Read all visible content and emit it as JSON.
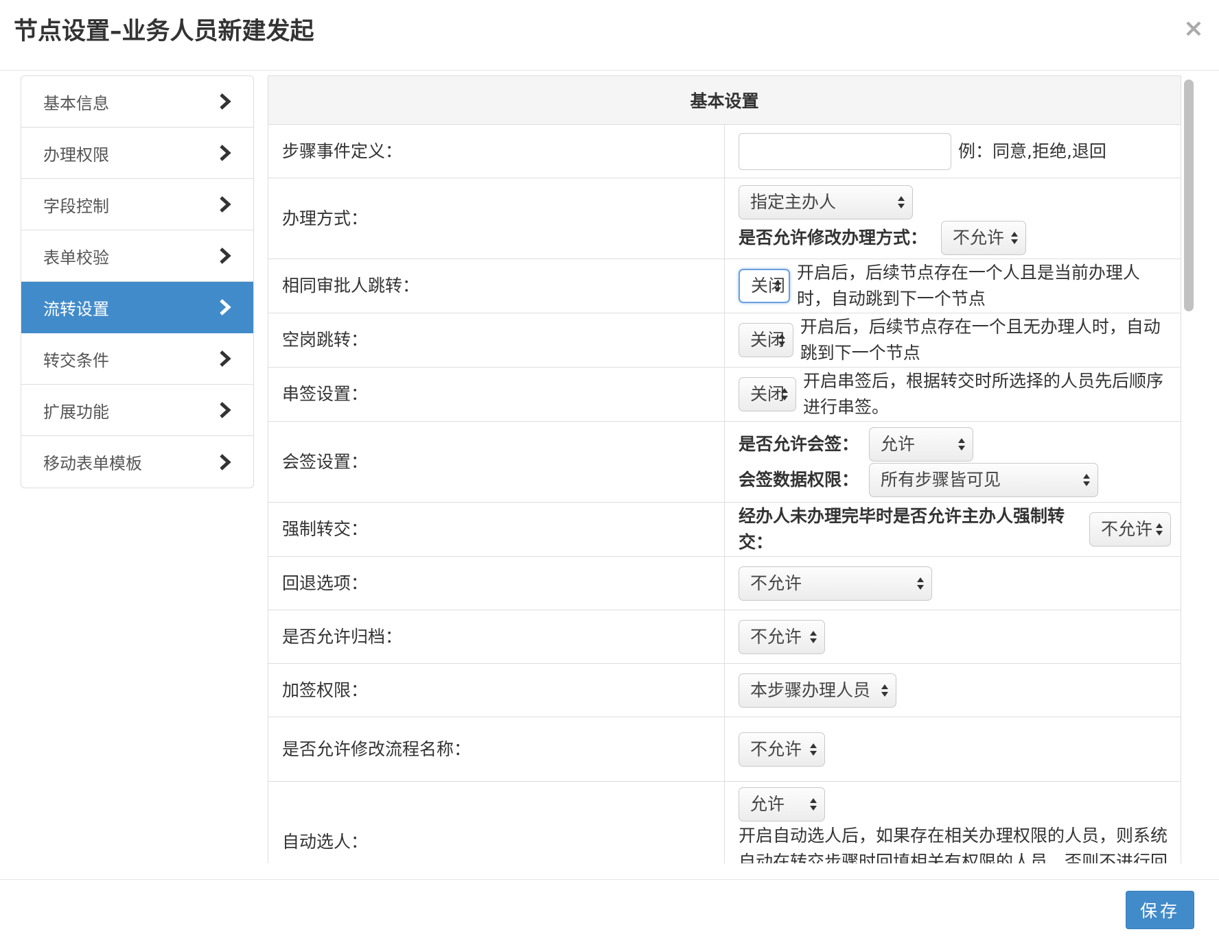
{
  "dialog": {
    "title": "节点设置–业务人员新建发起",
    "close_glyph": "×"
  },
  "sidebar": {
    "items": [
      {
        "label": "基本信息"
      },
      {
        "label": "办理权限"
      },
      {
        "label": "字段控制"
      },
      {
        "label": "表单校验"
      },
      {
        "label": "流转设置",
        "active": true
      },
      {
        "label": "转交条件"
      },
      {
        "label": "扩展功能"
      },
      {
        "label": "移动表单模板"
      }
    ],
    "chevron_icon": "chevron-right-icon"
  },
  "table": {
    "header": "基本设置",
    "step_event": {
      "label": "步骤事件定义：",
      "value": "",
      "hint": "例：同意,拒绝,退回"
    },
    "handle_mode": {
      "label": "办理方式：",
      "select": "指定主办人",
      "sub_label": "是否允许修改办理方式：",
      "sub_select": "不允许"
    },
    "same_approver": {
      "label": "相同审批人跳转：",
      "select": "关闭",
      "note": "开启后，后续节点存在一个人且是当前办理人时，自动跳到下一个节点"
    },
    "vacant_jump": {
      "label": "空岗跳转：",
      "select": "关闭",
      "note": "开启后，后续节点存在一个且无办理人时，自动跳到下一个节点"
    },
    "serial_sign": {
      "label": "串签设置：",
      "select": "关闭",
      "note": "开启串签后，根据转交时所选择的人员先后顺序进行串签。"
    },
    "countersign": {
      "label": "会签设置：",
      "allow_label": "是否允许会签：",
      "allow_select": "允许",
      "perm_label": "会签数据权限：",
      "perm_select": "所有步骤皆可见"
    },
    "force_transfer": {
      "label": "强制转交：",
      "question": "经办人未办理完毕时是否允许主办人强制转交：",
      "select": "不允许"
    },
    "rollback": {
      "label": "回退选项：",
      "select": "不允许"
    },
    "archive": {
      "label": "是否允许归档：",
      "select": "不允许"
    },
    "add_sign": {
      "label": "加签权限：",
      "select": "本步骤办理人员"
    },
    "rename_flow": {
      "label": "是否允许修改流程名称：",
      "select": "不允许"
    },
    "auto_select": {
      "label": "自动选人：",
      "select": "允许",
      "note": "开启自动选人后，如果存在相关办理权限的人员，则系统自动在转交步骤时回填相关有权限的人员，否则不进行回填（可与一键转交功能配合使用）"
    }
  },
  "footer": {
    "save_label": "保存"
  },
  "colors": {
    "primary": "#428bca",
    "border": "#dddddd",
    "header_bg": "#f5f5f5"
  }
}
